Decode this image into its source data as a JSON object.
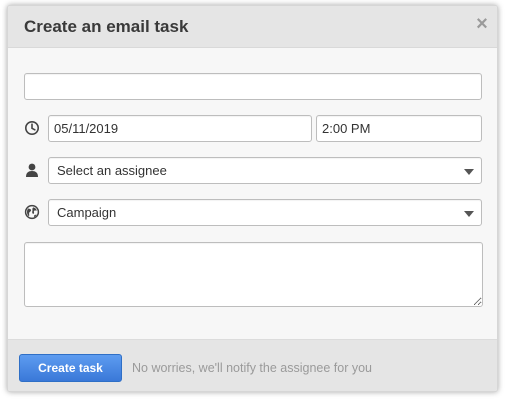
{
  "dialog": {
    "title": "Create an email task",
    "close_glyph": "×"
  },
  "form": {
    "subject": {
      "value": "",
      "placeholder": ""
    },
    "due_date": "05/11/2019",
    "due_time": "2:00 PM",
    "assignee": {
      "selected": "Select an assignee"
    },
    "related_to": {
      "selected": "Campaign"
    },
    "notes": {
      "value": ""
    }
  },
  "icons": {
    "date": "clock-icon",
    "assignee": "person-icon",
    "related": "globe-icon"
  },
  "footer": {
    "create_label": "Create task",
    "hint": "No worries, we'll notify the assignee for you"
  },
  "colors": {
    "primary_button": "#3a78d8",
    "header_bg": "#e5e5e5",
    "body_bg": "#f7f7f7"
  }
}
